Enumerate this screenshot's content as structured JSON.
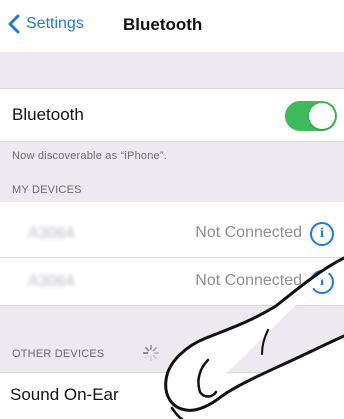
{
  "nav": {
    "back_label": "Settings",
    "title": "Bluetooth"
  },
  "bluetooth": {
    "label": "Bluetooth",
    "enabled": true,
    "discoverable_text": "Now discoverable as “iPhone”."
  },
  "my_devices": {
    "header": "MY DEVICES",
    "items": [
      {
        "name": "A3064",
        "status": "Not Connected",
        "icon": "info-icon"
      },
      {
        "name": "A3064",
        "status": "Not Connected",
        "icon": "info-icon"
      }
    ]
  },
  "other_devices": {
    "header": "OTHER DEVICES",
    "items": [
      {
        "name": "Sound On-Ear"
      }
    ]
  },
  "colors": {
    "accent": "#1f7ae0",
    "toggle_on": "#3dbb5a",
    "group_background": "#eceaf0"
  }
}
